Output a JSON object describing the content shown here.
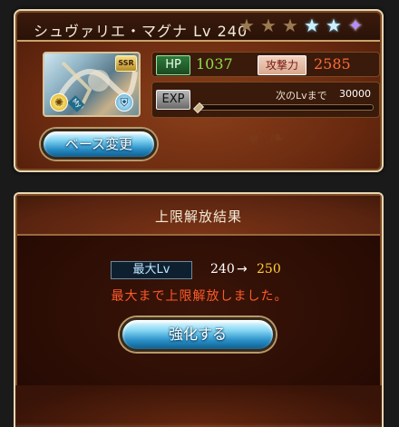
{
  "character": {
    "name": "シュヴァリエ・マグナ",
    "level_label": "Lv",
    "level": "240",
    "rarity": "SSR",
    "element_icon": "light-icon",
    "type_icon": "defense-icon",
    "my_badge": "My",
    "stars": [
      "bronze",
      "bronze",
      "bronze",
      "blue",
      "blue",
      "gem"
    ]
  },
  "stats": {
    "hp_label": "HP",
    "hp": "1037",
    "atk_label": "攻撃力",
    "atk": "2585",
    "exp_label": "EXP",
    "next_label": "次のLvまで",
    "next_value": "30000",
    "exp_progress": 0.0
  },
  "buttons": {
    "base_change": "ベース変更",
    "enhance": "強化する"
  },
  "result": {
    "title": "上限解放結果",
    "max_lv_label": "最大Lv",
    "from": "240",
    "arrow": "→",
    "to": "250",
    "message": "最大まで上限解放しました。"
  },
  "colors": {
    "hp": "#8ce04a",
    "atk": "#ff6a3a",
    "lv_to": "#ffcf3a",
    "message": "#ff5a2a",
    "button_blue": "#2a90c8"
  }
}
